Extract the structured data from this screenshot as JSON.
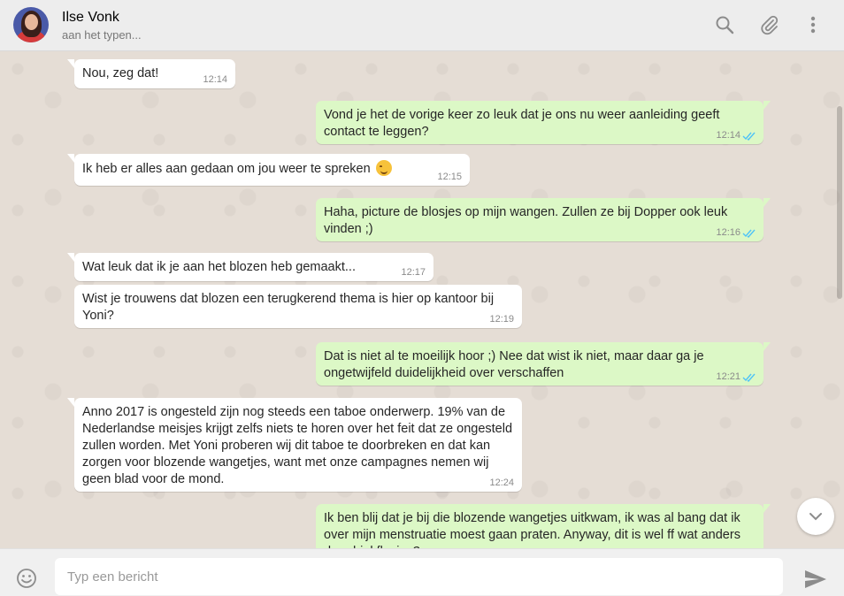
{
  "header": {
    "contact_name": "Ilse Vonk",
    "status": "aan het typen..."
  },
  "icons": {
    "search": "search-icon",
    "attach": "paperclip-icon",
    "menu": "more-vertical-icon",
    "emoji": "smiley-icon",
    "send": "send-icon",
    "scroll": "chevron-down-icon"
  },
  "colors": {
    "incoming_bubble": "#ffffff",
    "outgoing_bubble": "#dcf8c6",
    "read_ticks": "#4fc3f7",
    "chat_background": "#e5ddd5"
  },
  "messages": [
    {
      "dir": "in",
      "text": "Nou, zeg dat!",
      "time": "12:14"
    },
    {
      "dir": "out",
      "text": "Vond je het de vorige keer zo leuk dat je ons nu weer aanleiding geeft contact te leggen?",
      "time": "12:14",
      "status": "read"
    },
    {
      "dir": "in",
      "text": "Ik heb er alles aan gedaan om jou weer te spreken",
      "emoji": "winking-face",
      "time": "12:15"
    },
    {
      "dir": "out",
      "text": "Haha, picture de blosjes op mijn wangen. Zullen ze bij Dopper ook leuk vinden ;)",
      "time": "12:16",
      "status": "read"
    },
    {
      "dir": "in",
      "text": "Wat leuk dat ik je aan het blozen heb gemaakt...",
      "time": "12:17"
    },
    {
      "dir": "in",
      "text": "Wist je trouwens dat blozen een terugkerend thema is hier op kantoor bij Yoni?",
      "time": "12:19"
    },
    {
      "dir": "out",
      "text": "Dat is niet al te moeilijk hoor ;) Nee dat wist ik niet, maar daar ga je ongetwijfeld duidelijkheid over verschaffen",
      "time": "12:21",
      "status": "read"
    },
    {
      "dir": "in",
      "text": "Anno 2017 is ongesteld zijn nog steeds een taboe onderwerp. 19% van de Nederlandse meisjes krijgt zelfs niets te horen over het feit dat ze ongesteld zullen worden. Met Yoni proberen wij dit taboe te doorbreken en dat kan zorgen voor blozende wangetjes, want met onze campagnes nemen wij geen blad voor de mond.",
      "time": "12:24"
    },
    {
      "dir": "out",
      "text": "Ik ben blij dat je bij die blozende wangetjes uitkwam, ik was al bang dat ik over mijn menstruatie moest gaan praten. Anyway, dit is wel ff wat anders dan drinkflesjes?",
      "time": "",
      "status": "read"
    }
  ],
  "composer": {
    "placeholder": "Typ een bericht"
  }
}
